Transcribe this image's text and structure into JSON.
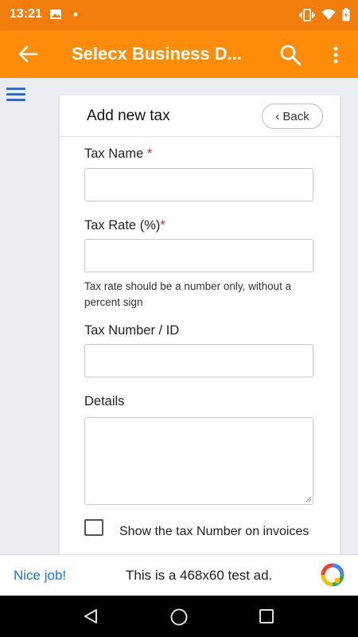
{
  "status_bar": {
    "time": "13:21",
    "icons": [
      "image-icon",
      "dot-icon",
      "vibrate-icon",
      "wifi-icon",
      "battery-charging-icon"
    ]
  },
  "app_bar": {
    "title": "Selecx Business D...",
    "icons": [
      "back-arrow-icon",
      "search-icon",
      "more-vert-icon"
    ],
    "color": "#fd8c0a"
  },
  "sidebar": {
    "icon": "hamburger-menu-icon",
    "color": "#2b6ed1"
  },
  "form": {
    "title": "Add new tax",
    "back_label": "‹ Back",
    "fields": {
      "tax_name": {
        "label": "Tax Name ",
        "required_mark": "*",
        "value": ""
      },
      "tax_rate": {
        "label": "Tax Rate (%)",
        "required_mark": "*",
        "value": "",
        "help": "Tax rate should be a number only, without a percent sign"
      },
      "tax_number": {
        "label": "Tax Number / ID",
        "value": ""
      },
      "details": {
        "label": "Details",
        "value": ""
      }
    },
    "checkbox": {
      "label": "Show the tax Number on invoices",
      "checked": false
    }
  },
  "ad": {
    "left_text": "Nice job!",
    "text": "This is a 468x60 test ad.",
    "logo": "ad-choices-logo-icon"
  },
  "nav_bar": {
    "icons": [
      "nav-back-icon",
      "nav-home-icon",
      "nav-recents-icon"
    ]
  }
}
